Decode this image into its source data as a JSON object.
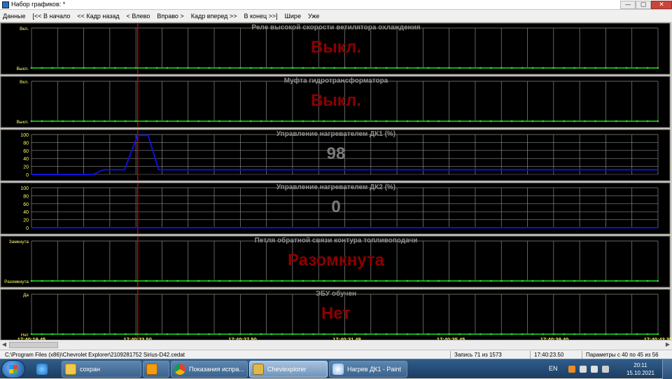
{
  "window": {
    "title": "Набор графиков: *",
    "controls": [
      "—",
      "▢",
      "✕"
    ]
  },
  "menu": [
    "Данные",
    "[<< В начало",
    "<< Кадр назад",
    "< Влево",
    "Вправо >",
    "Кадр вперед >>",
    "В конец >>]",
    "Шире",
    "Уже"
  ],
  "colors": {
    "plot_bg": "#000000",
    "grid": "#8a8a8a",
    "green_trace": "#22dd22",
    "blue_trace": "#1010dd",
    "cursor": "#cc0000",
    "state_text": "#8b0000",
    "value_text": "#7a7a7a",
    "title_text": "#8f8f8f",
    "axis_text": "#ffff66",
    "time_text": "#ffff66"
  },
  "chart_data": [
    {
      "type": "line",
      "title": "Реле высокой скорости ветилятора охлаждения",
      "current_value": "Выкл.",
      "value_style": "state",
      "y_ticks": [
        "Вкл.",
        "Выкл."
      ],
      "ylim": [
        0,
        1
      ],
      "series": [
        {
          "color": "green",
          "x": [
            "17:40:19.45",
            "17:40:43.35"
          ],
          "values": [
            0,
            0
          ]
        }
      ]
    },
    {
      "type": "line",
      "title": "Муфта гидротрансформатора",
      "current_value": "Выкл.",
      "value_style": "state",
      "y_ticks": [
        "Вкл.",
        "Выкл."
      ],
      "ylim": [
        0,
        1
      ],
      "series": [
        {
          "color": "green",
          "x": [
            "17:40:19.45",
            "17:40:43.35"
          ],
          "values": [
            0,
            0
          ]
        }
      ]
    },
    {
      "type": "line",
      "title": "Управление нагревателем ДК1  (%)",
      "current_value": "98",
      "value_style": "numeric",
      "y_ticks": [
        "100",
        "80",
        "60",
        "40",
        "20",
        "0"
      ],
      "ylim": [
        0,
        100
      ],
      "series": [
        {
          "color": "blue",
          "x": [
            "17:40:19.45",
            "17:40:21.80",
            "17:40:22.20",
            "17:40:23.00",
            "17:40:23.50",
            "17:40:23.90",
            "17:40:24.30",
            "17:40:43.35"
          ],
          "values": [
            0,
            0,
            12,
            12,
            98,
            98,
            12,
            12
          ]
        }
      ]
    },
    {
      "type": "line",
      "title": "Управление нагревателем ДК2  (%)",
      "current_value": "0",
      "value_style": "numeric",
      "y_ticks": [
        "100",
        "80",
        "60",
        "40",
        "20",
        "0"
      ],
      "ylim": [
        0,
        100
      ],
      "series": [
        {
          "color": "blue",
          "x": [
            "17:40:19.45",
            "17:40:43.35"
          ],
          "values": [
            0,
            0
          ]
        }
      ]
    },
    {
      "type": "line",
      "title": "Петля обратной связи контура топливоподачи",
      "current_value": "Разомкнута",
      "value_style": "state",
      "y_ticks": [
        "Замкнута",
        "Разомкнута"
      ],
      "ylim": [
        0,
        1
      ],
      "series": [
        {
          "color": "green",
          "x": [
            "17:40:19.45",
            "17:40:43.35"
          ],
          "values": [
            0,
            0
          ]
        }
      ]
    },
    {
      "type": "line",
      "title": "ЭБУ обучен",
      "current_value": "Нет",
      "value_style": "state",
      "y_ticks": [
        "Да",
        "Нет"
      ],
      "ylim": [
        0,
        1
      ],
      "series": [
        {
          "color": "green",
          "x": [
            "17:40:19.45",
            "17:40:43.35"
          ],
          "values": [
            0,
            0
          ]
        }
      ]
    }
  ],
  "time_axis": {
    "labels": [
      "17:40:19.45",
      "17:40:23.50",
      "17:40:27.50",
      "17:40:31.48",
      "17:40:35.45",
      "17:40:39.40",
      "17:40:43.35"
    ],
    "cursor_time": "17:40:23.50"
  },
  "statusbar": {
    "file": "C:\\Program Files (x86)\\Chevrolet Explorer\\2109281752 Sirius-D42.cedat",
    "record": "Запись 71 из 1573",
    "time": "17:40:23.50",
    "params": "Параметры с 40 по 45 из 56"
  },
  "taskbar": {
    "tasks": [
      {
        "label": "сохран",
        "icon": "folder-icon",
        "active": false
      },
      {
        "label": "",
        "icon": "media-player-icon",
        "active": false
      },
      {
        "label": "Показания испра...",
        "icon": "chrome-icon",
        "active": false
      },
      {
        "label": "Cheviexplorer",
        "icon": "cheviexplorer-icon",
        "active": true
      },
      {
        "label": "Нагрев ДК1 - Paint",
        "icon": "paint-icon",
        "active": false
      }
    ],
    "lang": "EN",
    "clock_time": "20:11",
    "clock_date": "15.10.2021"
  }
}
